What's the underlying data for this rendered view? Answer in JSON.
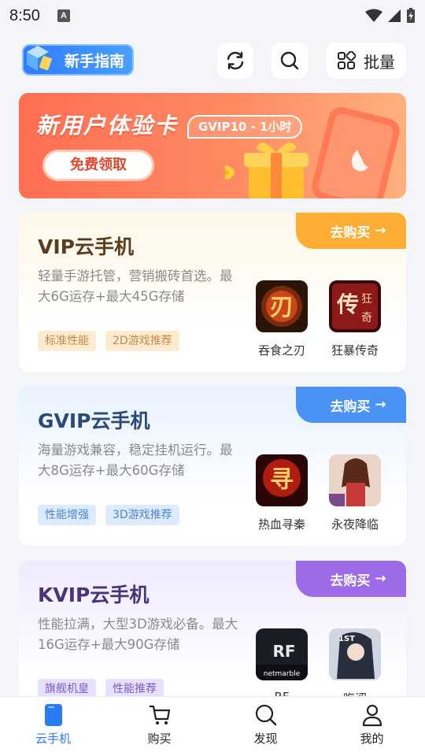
{
  "statusbar": {
    "time": "8:50"
  },
  "header": {
    "guide_label": "新手指南",
    "batch_label": "批量"
  },
  "promo": {
    "title": "新用户体验卡",
    "tag": "GVIP10 - 1小时",
    "button": "免费领取"
  },
  "cards": [
    {
      "title": "VIP云手机",
      "desc": "轻量手游托管，营销搬砖首选。最大6G运存+最大45G存储",
      "tags": [
        "标准性能",
        "2D游戏推荐"
      ],
      "buy": "去购买",
      "games": [
        "吞食之刃",
        "狂暴传奇"
      ]
    },
    {
      "title": "GVIP云手机",
      "desc": "海量游戏兼容，稳定挂机运行。最大8G运存+最大60G存储",
      "tags": [
        "性能增强",
        "3D游戏推荐"
      ],
      "buy": "去购买",
      "games": [
        "热血寻秦",
        "永夜降临"
      ]
    },
    {
      "title": "KVIP云手机",
      "desc": "性能拉满，大型3D游戏必备。最大16G运存+最大90G存储",
      "tags": [
        "旗舰机皇",
        "性能推荐"
      ],
      "buy": "去购买",
      "games": [
        "RF",
        "晦涩"
      ]
    }
  ],
  "nav": [
    "云手机",
    "购买",
    "发现",
    "我的"
  ],
  "colors": {
    "accent_blue": "#2a7cf6",
    "vip_orange": "#ffae35",
    "gvip_blue": "#4a93f5",
    "kvip_purple": "#9d6ae8",
    "promo_red": "#ff6e52"
  }
}
